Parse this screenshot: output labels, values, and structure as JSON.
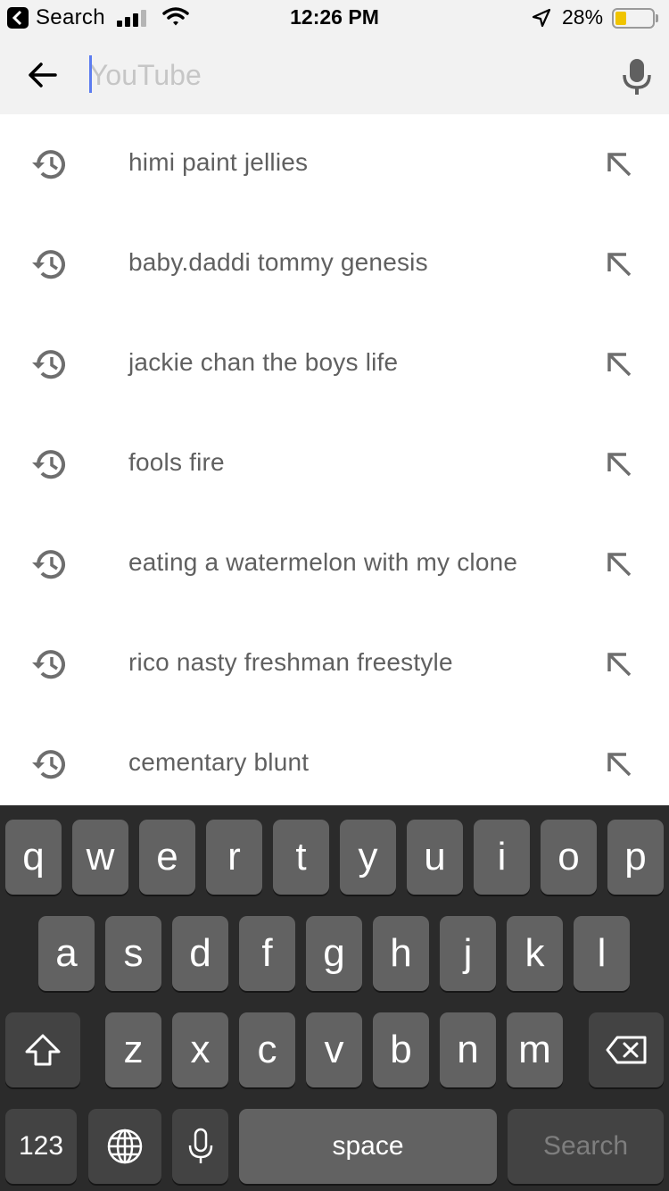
{
  "status_bar": {
    "back_app": "Search",
    "time": "12:26 PM",
    "battery": "28%",
    "icons": [
      "back-app-icon",
      "signal-icon",
      "wifi-icon",
      "location-icon",
      "battery-icon"
    ],
    "battery_color": "#f0c400"
  },
  "search": {
    "placeholder": "YouTube",
    "value": "",
    "caret_color": "#5c7cf0",
    "icons": [
      "back-arrow-icon",
      "microphone-icon"
    ]
  },
  "suggestions": [
    {
      "text": "himi paint jellies"
    },
    {
      "text": "baby.daddi tommy genesis"
    },
    {
      "text": "jackie chan the boys life"
    },
    {
      "text": "fools fire"
    },
    {
      "text": "eating a watermelon with my clone"
    },
    {
      "text": "rico nasty freshman freestyle"
    },
    {
      "text": "cementary blunt"
    }
  ],
  "suggestion_icons": [
    "history-icon",
    "fill-query-arrow-icon"
  ],
  "keyboard": {
    "row1": [
      "q",
      "w",
      "e",
      "r",
      "t",
      "y",
      "u",
      "i",
      "o",
      "p"
    ],
    "row2": [
      "a",
      "s",
      "d",
      "f",
      "g",
      "h",
      "j",
      "k",
      "l"
    ],
    "row3": [
      "z",
      "x",
      "c",
      "v",
      "b",
      "n",
      "m"
    ],
    "numbers_label": "123",
    "space_label": "space",
    "search_label": "Search",
    "icons": [
      "shift-icon",
      "backspace-icon",
      "globe-icon",
      "dictation-mic-icon"
    ]
  }
}
